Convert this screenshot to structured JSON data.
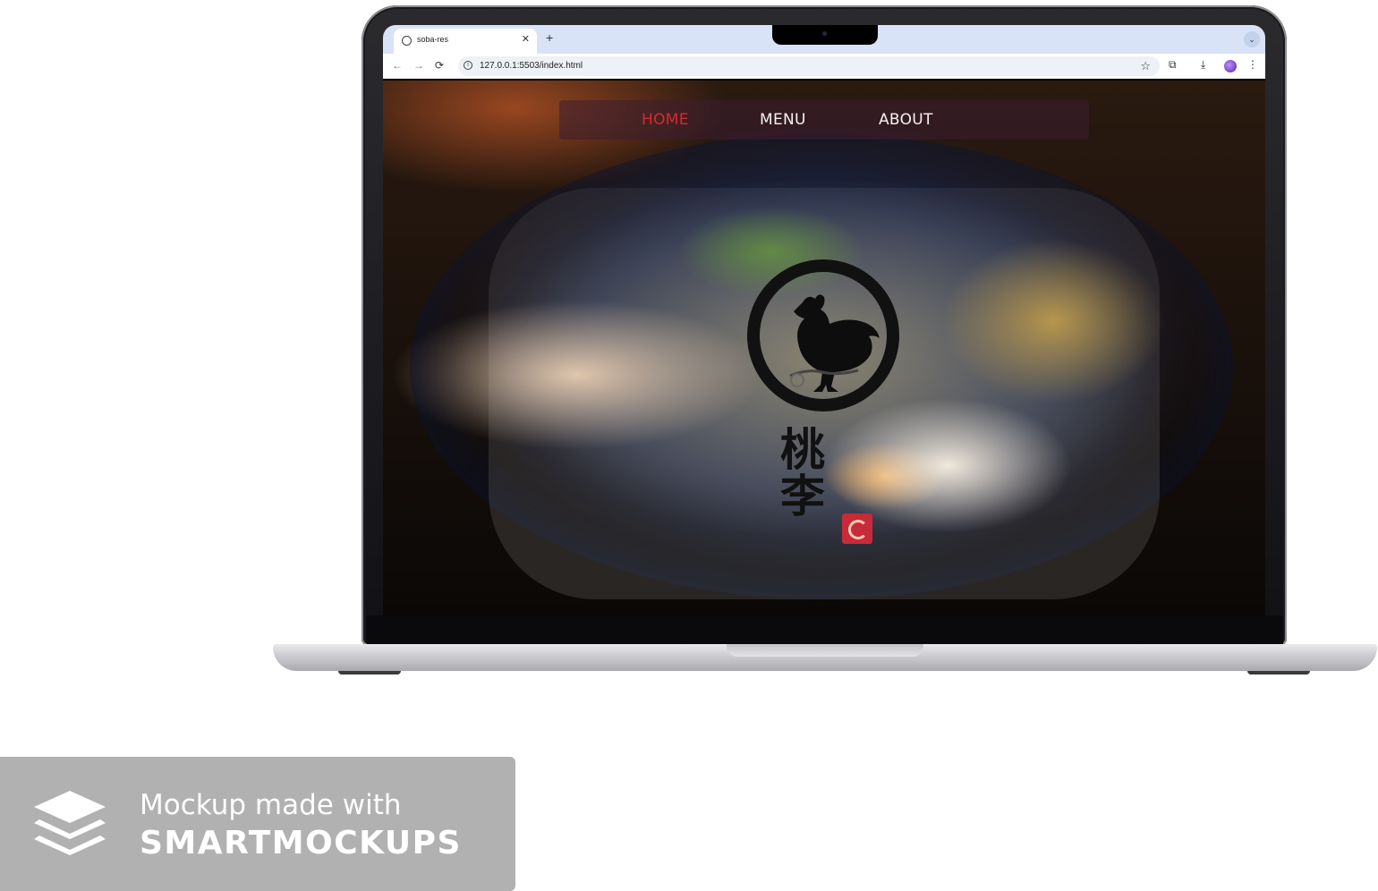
{
  "browser": {
    "tab_title": "soba-res",
    "tab_close": "✕",
    "new_tab": "+",
    "tab_search": "⌄",
    "url": "127.0.0.1:5503/index.html",
    "back": "←",
    "forward": "→",
    "reload": "⟳",
    "star": "☆",
    "extensions": "⧉",
    "download": "⤓",
    "menu": "⋮"
  },
  "site": {
    "nav": {
      "home": "HOME",
      "menu": "MENU",
      "about": "ABOUT",
      "active_color": "#d7282f"
    },
    "logo_kanji": "桃李",
    "logo_icon": "rooster-icon",
    "seal_icon": "red-seal-icon"
  },
  "watermark": {
    "line1": "Mockup made with",
    "line2": "SMARTMOCKUPS",
    "icon": "stacked-layers-icon"
  }
}
